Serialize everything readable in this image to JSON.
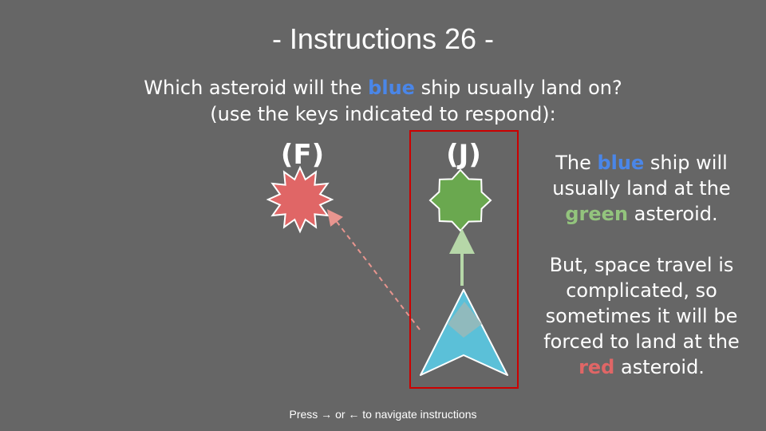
{
  "title": "- Instructions 26 -",
  "question": {
    "line1_before": "Which asteroid will the ",
    "line1_highlight": "blue",
    "line1_after": " ship usually land on?",
    "line2": "(use the keys indicated to respond):"
  },
  "keys": {
    "left": "(F)",
    "right": "(J)"
  },
  "explanation": {
    "p1_part1": "The ",
    "p1_blue": "blue",
    "p1_part2": " ship will usually land at the ",
    "p1_green": "green",
    "p1_part3": " asteroid.",
    "p2_part1": "But, space travel is complicated, so sometimes it will be forced to land at the ",
    "p2_red": "red",
    "p2_part2": " asteroid."
  },
  "nav_hint": "Press → or ← to navigate instructions",
  "colors": {
    "background": "#666666",
    "blue_text": "#4a86e8",
    "green_text": "#93c47d",
    "red_text": "#e06666",
    "red_asteroid": "#e06666",
    "green_asteroid": "#6aa84f",
    "ship": "#5bc0d8",
    "highlight_border": "#cc0000"
  },
  "icons": {
    "red_asteroid": "red-spiky-star",
    "green_asteroid": "green-eight-point-star",
    "ship": "blue-arrowhead-ship",
    "likely_path": "solid-green-arrow",
    "unlikely_path": "dashed-red-arrow"
  }
}
